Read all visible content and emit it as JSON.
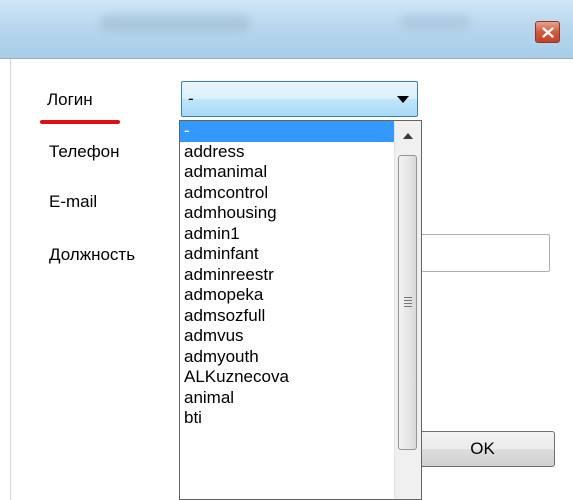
{
  "window": {
    "close_glyph": "close-icon"
  },
  "form": {
    "labels": {
      "login": "Логин",
      "phone": "Телефон",
      "email": "E-mail",
      "position": "Должность"
    },
    "login_combo": {
      "selected_value": "-"
    },
    "position_field": {
      "value": ""
    },
    "ok_button": "OK"
  },
  "dropdown": {
    "items": [
      "-",
      "address",
      "admanimal",
      "admcontrol",
      "admhousing",
      "admin1",
      "adminfant",
      "adminreestr",
      "admopeka",
      "admsozfull",
      "admvus",
      "admyouth",
      "ALKuznecova",
      "animal",
      "bti"
    ],
    "selected_index": 0
  },
  "colors": {
    "selection": "#3399ff",
    "underline": "#e01010",
    "titlebar": "#b9d7ee",
    "close_button": "#c2412a"
  }
}
